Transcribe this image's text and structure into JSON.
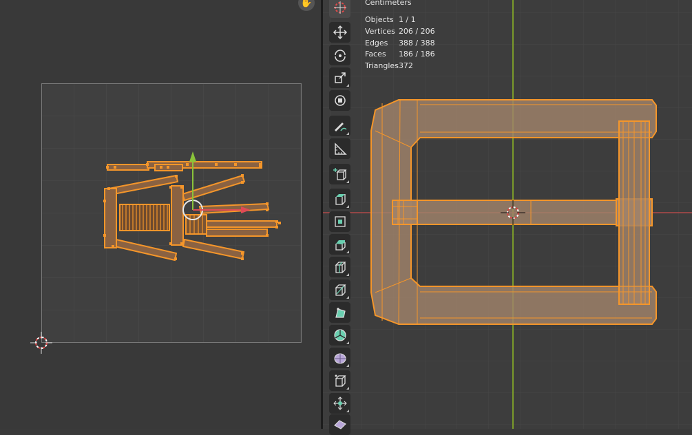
{
  "viewport": {
    "units_label": "Centimeters",
    "stats": [
      {
        "label": "Objects",
        "value": "1 / 1"
      },
      {
        "label": "Vertices",
        "value": "206 / 206"
      },
      {
        "label": "Edges",
        "value": "388 / 388"
      },
      {
        "label": "Faces",
        "value": "186 / 186"
      },
      {
        "label": "Triangles",
        "value": "372"
      }
    ]
  },
  "toolbar": {
    "tools": [
      {
        "name": "cursor-tool",
        "icon": "cursor-icon"
      },
      {
        "name": "move-tool",
        "icon": "move-icon"
      },
      {
        "name": "rotate-tool",
        "icon": "rotate-icon"
      },
      {
        "name": "scale-tool",
        "icon": "scale-icon"
      },
      {
        "name": "transform-tool",
        "icon": "transform-icon"
      },
      {
        "name": "annotate-tool",
        "icon": "annotate-icon"
      },
      {
        "name": "measure-tool",
        "icon": "measure-icon"
      },
      {
        "name": "add-cube-tool",
        "icon": "add-cube-icon"
      },
      {
        "name": "extrude-tool",
        "icon": "extrude-icon"
      },
      {
        "name": "inset-tool",
        "icon": "inset-icon"
      },
      {
        "name": "bevel-tool",
        "icon": "bevel-icon"
      },
      {
        "name": "loop-cut-tool",
        "icon": "loop-cut-icon"
      },
      {
        "name": "knife-tool",
        "icon": "knife-icon"
      },
      {
        "name": "poly-build-tool",
        "icon": "poly-build-icon"
      },
      {
        "name": "spin-tool",
        "icon": "spin-icon"
      },
      {
        "name": "smooth-tool",
        "icon": "smooth-icon"
      },
      {
        "name": "edge-slide-tool",
        "icon": "edge-slide-icon"
      },
      {
        "name": "shrink-fatten-tool",
        "icon": "shrink-fatten-icon"
      },
      {
        "name": "shear-tool",
        "icon": "shear-icon"
      }
    ]
  },
  "colors": {
    "selection": "#f5962a",
    "selection_fill": "#a0826a",
    "x_axis": "#b04a4a",
    "y_axis": "#7a9a2a",
    "gizmo_z": "#8ac43a",
    "gizmo_x": "#e04a55"
  }
}
